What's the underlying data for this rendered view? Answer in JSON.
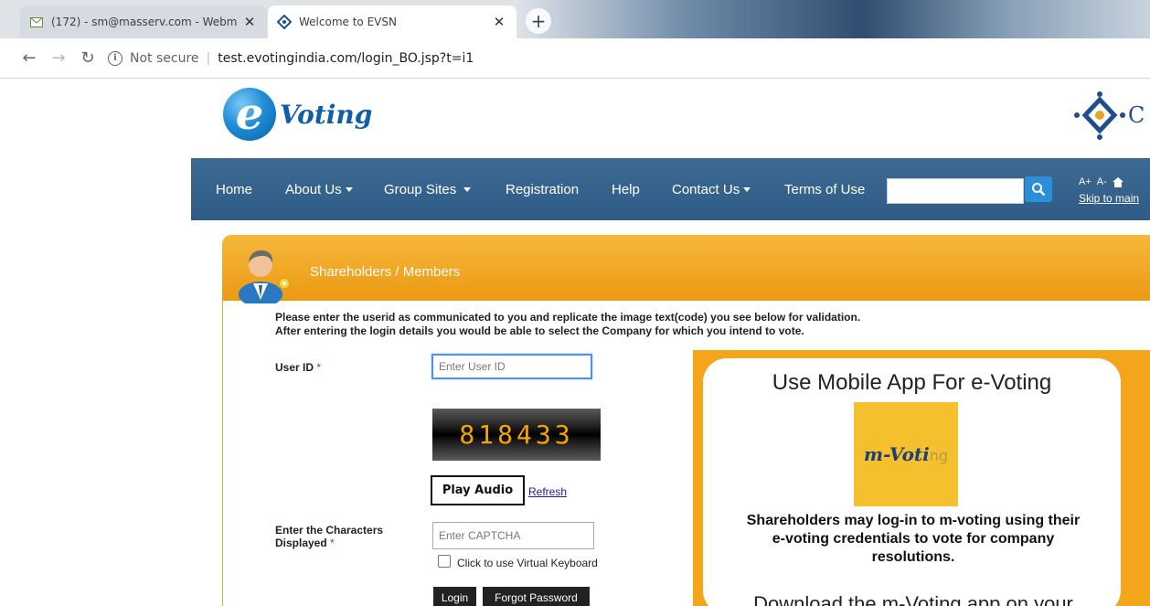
{
  "browser": {
    "tabs": [
      {
        "title": "(172) - sm@masserv.com - Webm",
        "icon": "mail-icon"
      },
      {
        "title": "Welcome to EVSN",
        "icon": "cdsl-favicon"
      }
    ],
    "security_label": "Not secure",
    "url": "test.evotingindia.com/login_BO.jsp?t=i1"
  },
  "header": {
    "logo_text": "Voting",
    "logo_letter": "e",
    "right_logo_letter": "C"
  },
  "nav": {
    "items": [
      "Home",
      "About Us",
      "Group Sites",
      "Registration",
      "Help",
      "Contact Us",
      "Terms of Use"
    ],
    "search_value": "",
    "font_larger": "A+",
    "font_smaller": "A-",
    "skip_link": "Skip to main"
  },
  "panel": {
    "title": "Shareholders / Members",
    "intro_line1": "Please enter the userid as communicated to you and replicate the image text(code) you see below for validation.",
    "intro_line2": "After entering the login details you would be able to select the Company for which you intend to vote."
  },
  "form": {
    "userid_label": "User ID",
    "required_mark": "*",
    "userid_placeholder": "Enter User ID",
    "captcha_code": "818433",
    "play_audio_label": "Play Audio",
    "refresh_label": "Refresh",
    "captcha_label_line1": "Enter the Characters",
    "captcha_label_line2": "Displayed",
    "captcha_placeholder": "Enter CAPTCHA",
    "virtual_keyboard_label": "Click to use Virtual Keyboard",
    "virtual_keyboard_checked": false,
    "login_label": "Login",
    "forgot_label": "Forgot Password"
  },
  "promo": {
    "title": "Use Mobile App For e-Voting",
    "logo_main": "m-Voti",
    "logo_tail": "ng",
    "desc_line1": "Shareholders may log-in to m-voting using their",
    "desc_line2": "e-voting credentials to vote for company",
    "desc_line3": "resolutions.",
    "download_text": "Download the m-Voting app on your"
  },
  "colors": {
    "navbar": "#3c6a93",
    "panel_orange": "#f0a623",
    "captcha_digits": "#f5a300",
    "search_button": "#2a8fd8"
  }
}
